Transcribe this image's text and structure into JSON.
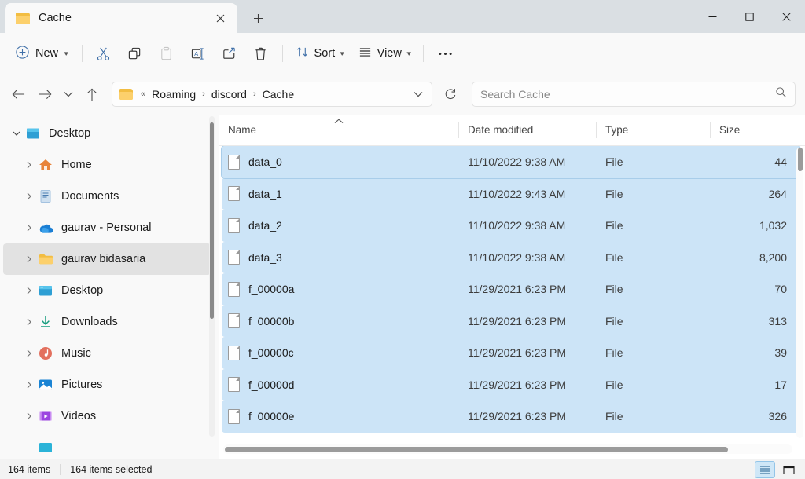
{
  "window": {
    "tab_title": "Cache",
    "tab_close_label": "✕",
    "new_tab_label": "+",
    "minimize_label": "minimize",
    "maximize_label": "maximize",
    "close_label": "close"
  },
  "toolbar": {
    "new_label": "New",
    "sort_label": "Sort",
    "view_label": "View",
    "more_label": "•••",
    "cut_name": "cut-icon",
    "copy_name": "copy-icon",
    "paste_name": "paste-icon",
    "rename_name": "rename-icon",
    "share_name": "share-icon",
    "delete_name": "delete-icon"
  },
  "address": {
    "back_label": "←",
    "forward_label": "→",
    "recent_label": "∨",
    "up_label": "↑",
    "prefix": "«",
    "crumbs": [
      "Roaming",
      "discord",
      "Cache"
    ],
    "separator": "›",
    "dropdown_label": "∨",
    "refresh_label": "refresh"
  },
  "search": {
    "placeholder": "Search Cache",
    "value": "",
    "icon_name": "search-icon"
  },
  "sidebar": {
    "items": [
      {
        "label": "Desktop",
        "level": 0,
        "expanded": true,
        "selected": false,
        "icon": "desktop-icon"
      },
      {
        "label": "Home",
        "level": 1,
        "expanded": false,
        "selected": false,
        "icon": "home-icon"
      },
      {
        "label": "Documents",
        "level": 1,
        "expanded": false,
        "selected": false,
        "icon": "documents-icon"
      },
      {
        "label": "gaurav - Personal",
        "level": 1,
        "expanded": false,
        "selected": false,
        "icon": "onedrive-icon"
      },
      {
        "label": "gaurav bidasaria",
        "level": 1,
        "expanded": false,
        "selected": true,
        "icon": "user-folder-icon"
      },
      {
        "label": "Desktop",
        "level": 1,
        "expanded": false,
        "selected": false,
        "icon": "desktop-icon"
      },
      {
        "label": "Downloads",
        "level": 1,
        "expanded": false,
        "selected": false,
        "icon": "downloads-icon"
      },
      {
        "label": "Music",
        "level": 1,
        "expanded": false,
        "selected": false,
        "icon": "music-icon"
      },
      {
        "label": "Pictures",
        "level": 1,
        "expanded": false,
        "selected": false,
        "icon": "pictures-icon"
      },
      {
        "label": "Videos",
        "level": 1,
        "expanded": false,
        "selected": false,
        "icon": "videos-icon"
      }
    ],
    "expand_glyph": "∨",
    "collapse_glyph": "›"
  },
  "columns": {
    "name": "Name",
    "date_modified": "Date modified",
    "type": "Type",
    "size": "Size",
    "sort_caret": "˄"
  },
  "files": [
    {
      "name": "data_0",
      "date": "11/10/2022 9:38 AM",
      "type": "File",
      "size": "44",
      "selected": true,
      "focused": true
    },
    {
      "name": "data_1",
      "date": "11/10/2022 9:43 AM",
      "type": "File",
      "size": "264",
      "selected": true,
      "focused": false
    },
    {
      "name": "data_2",
      "date": "11/10/2022 9:38 AM",
      "type": "File",
      "size": "1,032",
      "selected": true,
      "focused": false
    },
    {
      "name": "data_3",
      "date": "11/10/2022 9:38 AM",
      "type": "File",
      "size": "8,200",
      "selected": true,
      "focused": false
    },
    {
      "name": "f_00000a",
      "date": "11/29/2021 6:23 PM",
      "type": "File",
      "size": "70",
      "selected": true,
      "focused": false
    },
    {
      "name": "f_00000b",
      "date": "11/29/2021 6:23 PM",
      "type": "File",
      "size": "313",
      "selected": true,
      "focused": false
    },
    {
      "name": "f_00000c",
      "date": "11/29/2021 6:23 PM",
      "type": "File",
      "size": "39",
      "selected": true,
      "focused": false
    },
    {
      "name": "f_00000d",
      "date": "11/29/2021 6:23 PM",
      "type": "File",
      "size": "17",
      "selected": true,
      "focused": false
    },
    {
      "name": "f_00000e",
      "date": "11/29/2021 6:23 PM",
      "type": "File",
      "size": "326",
      "selected": true,
      "focused": false
    }
  ],
  "status": {
    "item_count": "164 items",
    "selected_count": "164 items selected",
    "details_view_name": "details-view-icon",
    "large_icons_view_name": "large-icons-view-icon"
  },
  "colors": {
    "accent": "#0078d4",
    "selection": "#cce4f7",
    "titlebar": "#dadfe3",
    "folder": "#fcd06c",
    "app_bg": "#f9f9f9"
  }
}
